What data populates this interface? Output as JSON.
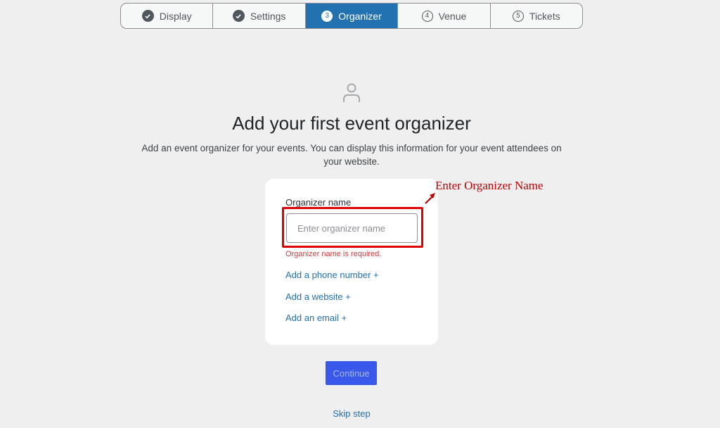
{
  "stepper": {
    "steps": [
      {
        "label": "Display",
        "state": "done"
      },
      {
        "label": "Settings",
        "state": "done"
      },
      {
        "label": "Organizer",
        "number": "3",
        "state": "active"
      },
      {
        "label": "Venue",
        "number": "4",
        "state": "pending"
      },
      {
        "label": "Tickets",
        "number": "5",
        "state": "pending"
      }
    ]
  },
  "hero": {
    "icon": "person-icon",
    "title": "Add your first event organizer",
    "subtitle": "Add an event organizer for your events. You can display this information for your event attendees on your website."
  },
  "form": {
    "name_label": "Organizer name",
    "name_placeholder": "Enter organizer name",
    "name_value": "",
    "error": "Organizer name is required.",
    "add_phone": "Add a phone number +",
    "add_website": "Add a website +",
    "add_email": "Add an email +"
  },
  "annotation": {
    "text": "Enter Organizer Name",
    "color": "#c00000"
  },
  "actions": {
    "continue": "Continue",
    "skip": "Skip step"
  },
  "colors": {
    "accent": "#2271b1",
    "button": "#3858e9",
    "error": "#d63638"
  }
}
